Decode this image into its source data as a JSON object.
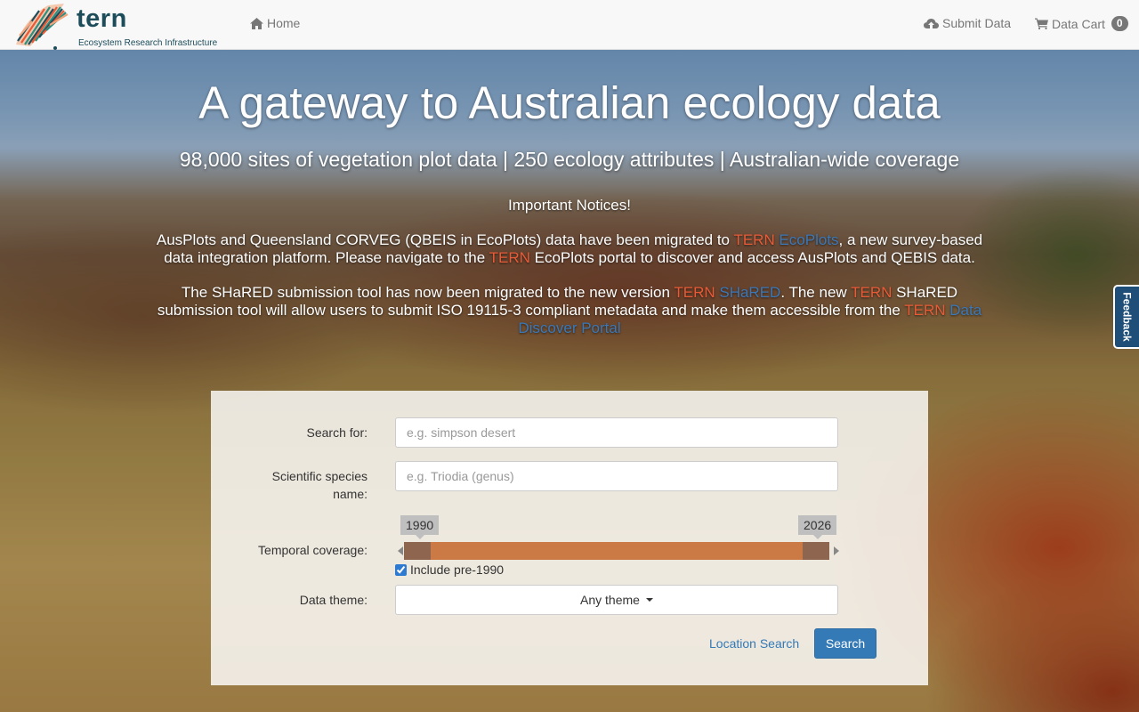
{
  "nav": {
    "logo_word": "tern",
    "logo_subtitle": "Ecosystem Research Infrastructure",
    "home": "Home",
    "submit": "Submit Data",
    "cart": "Data Cart",
    "cart_count": "0"
  },
  "hero": {
    "title": "A gateway to Australian ecology data",
    "subtitle": "98,000 sites of vegetation plot data | 250 ecology attributes | Australian-wide coverage"
  },
  "notices": {
    "heading": "Important Notices!",
    "p1": {
      "a": "AusPlots and Queensland CORVEG (QBEIS in EcoPlots) data have been migrated to ",
      "tern1": "TERN",
      "link1": "EcoPlots",
      "b": ", a new survey-based data integration platform. Please navigate to the ",
      "tern2": "TERN",
      "c": " EcoPlots portal to discover and access AusPlots and QEBIS data."
    },
    "p2": {
      "a": "The SHaRED submission tool has now been migrated to the new version ",
      "tern1": "TERN",
      "link1": "SHaRED",
      "b": ". The new ",
      "tern2": "TERN",
      "c": " SHaRED submission tool will allow users to submit ISO 19115-3 compliant metadata and make them accessible from the ",
      "tern3": "TERN",
      "link2": "Data Discover Portal"
    }
  },
  "feedback": "Feedback",
  "search": {
    "search_label": "Search for:",
    "search_placeholder": "e.g. simpson desert",
    "species_label": "Scientific species name:",
    "species_placeholder": "e.g. Triodia (genus)",
    "temporal_label": "Temporal coverage:",
    "year_min": "1990",
    "year_max": "2026",
    "include_pre": "Include pre-1990",
    "include_pre_checked": true,
    "theme_label": "Data theme:",
    "theme_value": "Any theme",
    "location_search": "Location Search",
    "search_button": "Search"
  }
}
